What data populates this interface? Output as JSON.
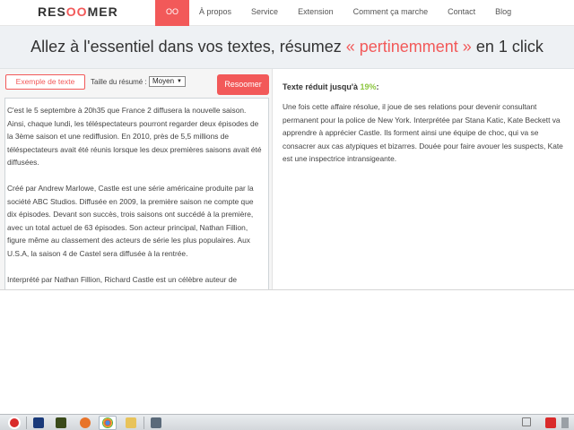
{
  "nav": {
    "logo_prefix": "RES",
    "logo_oo": "OO",
    "logo_suffix": "MER",
    "items": [
      {
        "label": "OO"
      },
      {
        "label": "À propos"
      },
      {
        "label": "Service"
      },
      {
        "label": "Extension"
      },
      {
        "label": "Comment ça marche"
      },
      {
        "label": "Contact"
      },
      {
        "label": "Blog"
      }
    ]
  },
  "hero": {
    "before": "Allez à l'essentiel dans vos textes, résumez ",
    "accent": "« pertinemment »",
    "after": " en 1 click"
  },
  "controls": {
    "example_label": "Exemple de texte",
    "size_label": "Taille du résumé :",
    "size_value": "Moyen",
    "summarize_label": "Resoomer"
  },
  "input_text": {
    "paragraphs": [
      "C'est le 5 septembre à 20h35 que France 2 diffusera la nouvelle saison. Ainsi, chaque lundi, les téléspectateurs pourront regarder deux épisodes de la 3ème saison et une rediffusion. En 2010, près de 5,5 millions de téléspectateurs avait été réunis lorsque les deux premières saisons avait été diffusées.",
      "Créé par Andrew Marlowe, Castle est une série américaine produite par la société ABC Studios. Diffusée en 2009, la première saison ne compte que dix épisodes. Devant son succès, trois saisons ont succédé à la première, avec un total actuel de 63 épisodes. Son acteur principal, Nathan Fillion, figure même au classement des acteurs de série les plus populaires. Aux U.S.A, la saison 4 de Castel sera diffusée à la rentrée.",
      "Interprété par Nathan Fillion, Richard Castle est un célèbre auteur de"
    ]
  },
  "result": {
    "title_prefix": "Texte réduit jusqu'à ",
    "percent": "19%",
    "title_suffix": ":",
    "text": "Une fois cette affaire résolue, il joue de ses relations pour devenir consultant permanent pour la police de New York. Interprétée par Stana Katic, Kate Beckett va apprendre à apprécier Castle. Ils forment ainsi une équipe de choc, qui va se consacrer aux cas atypiques et bizarres. Douée pour faire avouer les suspects, Kate est une inspectrice intransigeante."
  },
  "colors": {
    "accent": "#f25959",
    "percent": "#8cc63f"
  }
}
